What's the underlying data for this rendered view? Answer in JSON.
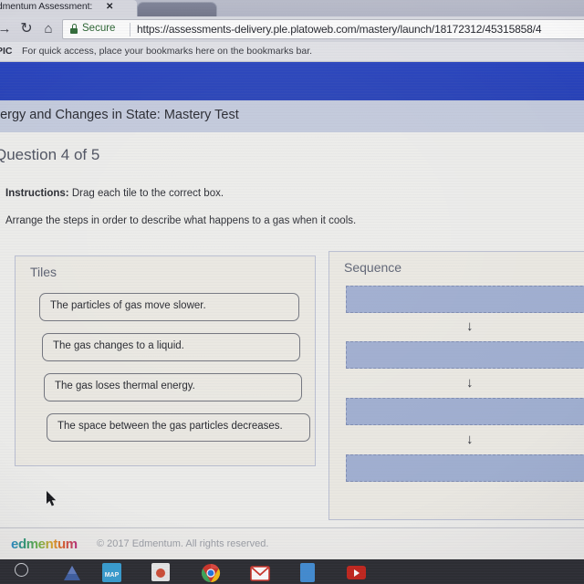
{
  "browser": {
    "tab": {
      "title": "Edmentum Assessment:",
      "close_icon": "close-icon"
    },
    "toolbar": {
      "forward_icon": "→",
      "reload_icon": "↻",
      "home_icon": "⌂",
      "security_label": "Secure",
      "url": "https://assessments-delivery.ple.platoweb.com/mastery/launch/18172312/45315858/4"
    },
    "bookmarks": {
      "first_label": "PIC",
      "hint": "For quick access, place your bookmarks here on the bookmarks bar."
    }
  },
  "assessment": {
    "title": "nergy and Changes in State: Mastery Test",
    "question_label": "Question 4 of 5",
    "instructions_prefix": "Instructions:",
    "instructions_text": " Drag each tile to the correct box.",
    "prompt": "Arrange the steps in order to describe what happens to a gas when it cools.",
    "tiles_panel": {
      "label": "Tiles",
      "tiles": [
        "The particles of gas move slower.",
        "The gas changes to a liquid.",
        "The gas loses thermal energy.",
        "The space between the gas particles decreases."
      ]
    },
    "sequence_panel": {
      "label": "Sequence",
      "slots": [
        "",
        "",
        "",
        ""
      ],
      "arrow_glyph": "↓",
      "slot_count": 4
    }
  },
  "footer": {
    "logo_text": "edmentum",
    "copyright": "© 2017 Edmentum. All rights reserved."
  },
  "taskbar": {
    "items": [
      {
        "name": "search-icon",
        "label": ""
      },
      {
        "name": "drive-icon",
        "label": ""
      },
      {
        "name": "maps-icon",
        "label": "MAP"
      },
      {
        "name": "photos-icon",
        "label": ""
      },
      {
        "name": "chrome-icon",
        "label": ""
      },
      {
        "name": "gmail-icon",
        "label": ""
      },
      {
        "name": "docs-icon",
        "label": ""
      },
      {
        "name": "youtube-icon",
        "label": ""
      }
    ]
  },
  "colors": {
    "header_blue": "#2340c2",
    "title_band": "#c4cbdf",
    "dropzone_fill": "#9fafd5",
    "page_bg": "#eeeeec",
    "secure_green": "#24642c"
  }
}
